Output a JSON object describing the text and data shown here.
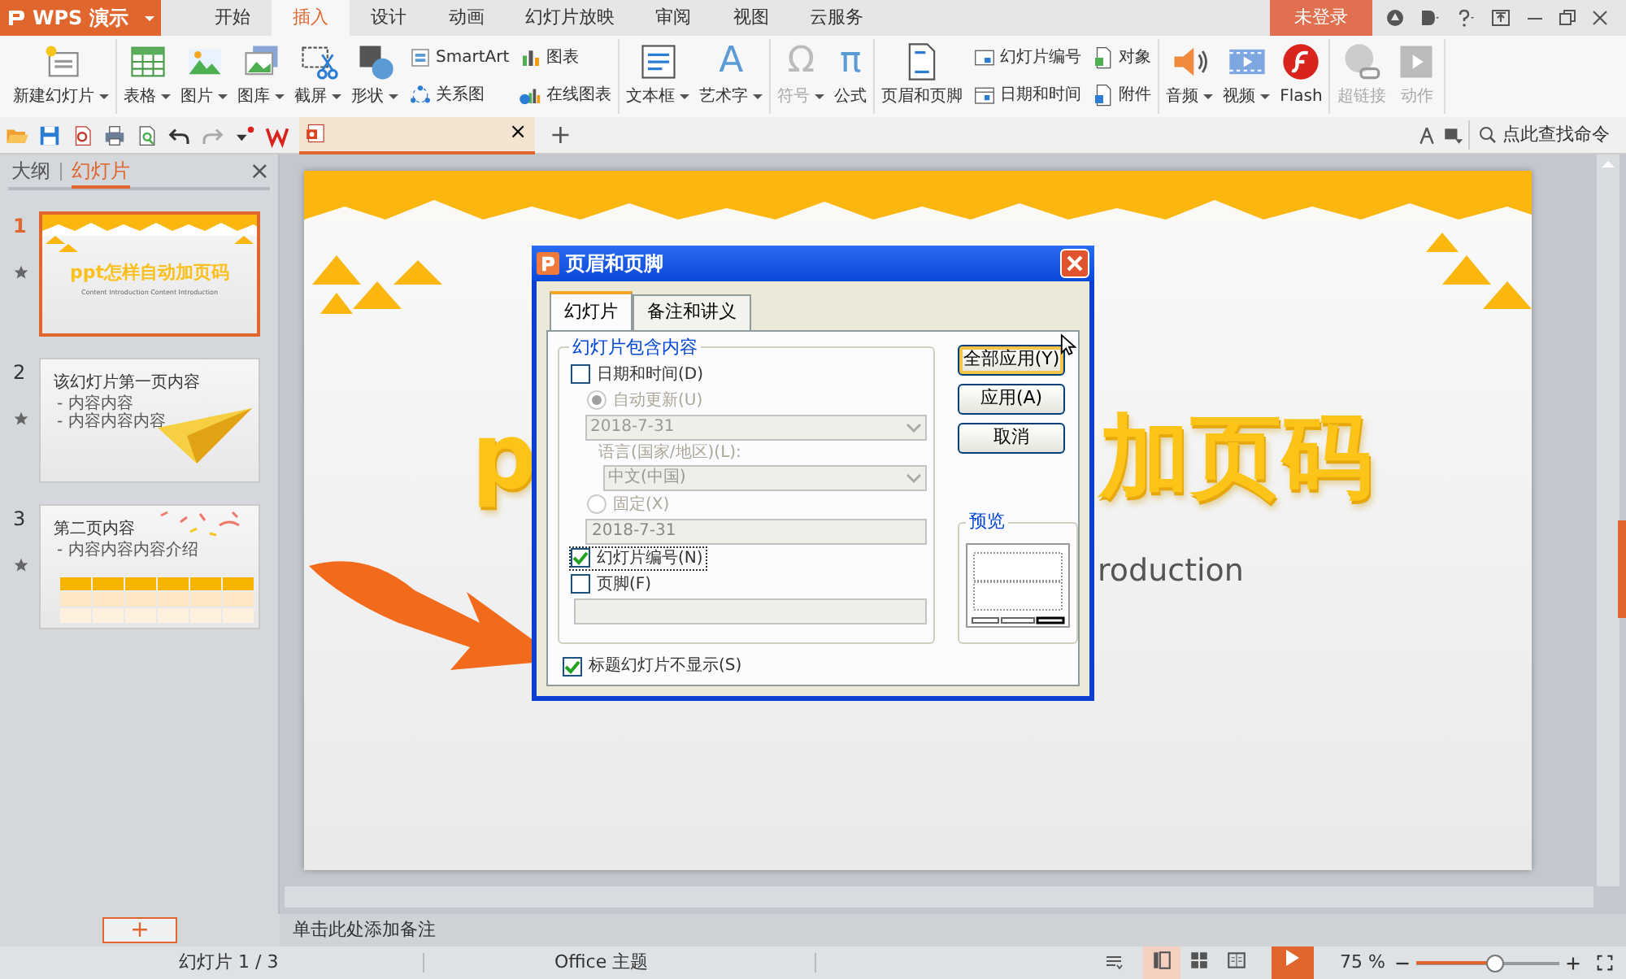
{
  "app": {
    "logo": "WPS 演示",
    "menu_tabs": [
      {
        "label": "开始",
        "selected": false
      },
      {
        "label": "插入",
        "selected": true
      },
      {
        "label": "设计",
        "selected": false
      },
      {
        "label": "动画",
        "selected": false
      },
      {
        "label": "幻灯片放映",
        "selected": false
      },
      {
        "label": "审阅",
        "selected": false
      },
      {
        "label": "视图",
        "selected": false
      },
      {
        "label": "云服务",
        "selected": false
      }
    ],
    "login": "未登录"
  },
  "ribbon": {
    "groups": [
      {
        "items": [
          {
            "kind": "big",
            "label": "新建幻灯片",
            "dropdown": true,
            "disabled": false
          }
        ]
      },
      {
        "items": [
          {
            "kind": "big",
            "label": "表格",
            "dropdown": true,
            "disabled": false
          },
          {
            "kind": "big",
            "label": "图片",
            "dropdown": true,
            "disabled": false
          },
          {
            "kind": "big",
            "label": "图库",
            "dropdown": true,
            "disabled": false
          },
          {
            "kind": "big",
            "label": "截屏",
            "dropdown": true,
            "disabled": false
          },
          {
            "kind": "big",
            "label": "形状",
            "dropdown": true,
            "disabled": false
          },
          {
            "kind": "stack",
            "items": [
              {
                "label": "SmartArt"
              },
              {
                "label": "关系图"
              }
            ]
          },
          {
            "kind": "stack",
            "items": [
              {
                "label": "图表"
              },
              {
                "label": "在线图表"
              }
            ]
          }
        ]
      },
      {
        "items": [
          {
            "kind": "big",
            "label": "文本框",
            "dropdown": true,
            "disabled": false
          },
          {
            "kind": "big",
            "label": "艺术字",
            "glyph": "A",
            "dropdown": true,
            "disabled": false
          }
        ]
      },
      {
        "items": [
          {
            "kind": "big",
            "label": "符号",
            "glyph": "Ω",
            "dropdown": true,
            "disabled": true
          },
          {
            "kind": "big",
            "label": "公式",
            "glyph": "π",
            "dropdown": false,
            "disabled": false
          }
        ]
      },
      {
        "items": [
          {
            "kind": "big",
            "label": "页眉和页脚",
            "dropdown": false,
            "disabled": false
          },
          {
            "kind": "stack",
            "items": [
              {
                "label": "幻灯片编号"
              },
              {
                "label": "日期和时间"
              }
            ]
          },
          {
            "kind": "stack",
            "items": [
              {
                "label": "对象"
              },
              {
                "label": "附件"
              }
            ]
          }
        ]
      },
      {
        "items": [
          {
            "kind": "big",
            "label": "音频",
            "dropdown": true,
            "disabled": false
          },
          {
            "kind": "big",
            "label": "视频",
            "dropdown": true,
            "disabled": false
          },
          {
            "kind": "big",
            "label": "Flash",
            "dropdown": false,
            "disabled": false
          }
        ]
      },
      {
        "items": [
          {
            "kind": "big",
            "label": "超链接",
            "dropdown": false,
            "disabled": true
          },
          {
            "kind": "big",
            "label": "动作",
            "dropdown": false,
            "disabled": true
          }
        ]
      }
    ]
  },
  "quick_toolbar": {
    "doc_close": "×",
    "new_tab": "+",
    "search": "点此查找命令"
  },
  "panel": {
    "tabs": [
      {
        "label": "大纲",
        "selected": false
      },
      {
        "label": "幻灯片",
        "selected": true
      }
    ],
    "close": "×",
    "slides": [
      {
        "number": "1",
        "selected": true,
        "kind": "title",
        "title": "ppt怎样自动加页码",
        "subtitle": "Content Introduction Content Introduction"
      },
      {
        "number": "2",
        "selected": false,
        "kind": "bullets",
        "title": "该幻灯片第一页内容",
        "bullets": [
          "- 内容内容",
          "- 内容内容内容"
        ]
      },
      {
        "number": "3",
        "selected": false,
        "kind": "table",
        "title": "第二页内容",
        "bullets": [
          "- 内容内容内容介绍"
        ]
      }
    ],
    "add": "+"
  },
  "slide": {
    "title_parts": [
      "p",
      "加页码"
    ],
    "subtitle": "roduction"
  },
  "dialog": {
    "title": "页眉和页脚",
    "tabs": [
      {
        "label": "幻灯片",
        "selected": true
      },
      {
        "label": "备注和讲义",
        "selected": false
      }
    ],
    "group_label": "幻灯片包含内容",
    "fields": [
      {
        "kind": "checkbox",
        "label": "日期和时间(D)",
        "checked": false,
        "disabled": false
      },
      {
        "kind": "radio",
        "label": "自动更新(U)",
        "selected": true,
        "disabled": true
      },
      {
        "kind": "select",
        "value": "2018-7-31",
        "disabled": true
      },
      {
        "kind": "caption",
        "label": "语言(国家/地区)(L):",
        "disabled": true
      },
      {
        "kind": "subselect",
        "value": "中文(中国)",
        "disabled": true
      },
      {
        "kind": "radio",
        "label": "固定(X)",
        "selected": false,
        "disabled": true
      },
      {
        "kind": "input",
        "value": "2018-7-31",
        "disabled": true
      },
      {
        "kind": "checkbox",
        "label": "幻灯片编号(N)",
        "checked": true,
        "disabled": false
      },
      {
        "kind": "checkbox",
        "label": "页脚(F)",
        "checked": false,
        "disabled": false
      },
      {
        "kind": "wideinput",
        "disabled": true
      }
    ],
    "title_slide": {
      "label": "标题幻灯片不显示(S)",
      "checked": true
    },
    "buttons": [
      {
        "label": "全部应用(Y)",
        "default": true
      },
      {
        "label": "应用(A)",
        "default": false
      },
      {
        "label": "取消",
        "default": false
      }
    ],
    "preview_label": "预览"
  },
  "notes": {
    "placeholder": "单击此处添加备注"
  },
  "status_bar": {
    "slide_count": "幻灯片 1 / 3",
    "theme": "Office 主题",
    "views": [
      {
        "selected": true
      },
      {
        "selected": false
      },
      {
        "selected": false
      }
    ],
    "zoom": {
      "reading": "75 %",
      "level": 0.55
    }
  }
}
